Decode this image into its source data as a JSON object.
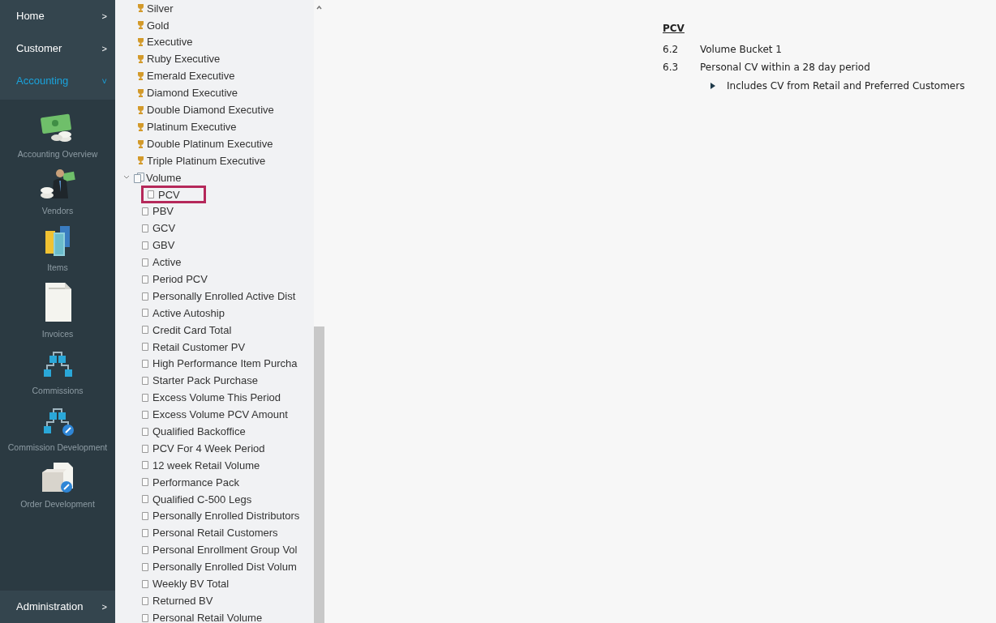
{
  "sidebar": {
    "menu_top": [
      {
        "label": "Home",
        "chevron": ">",
        "expanded": false
      },
      {
        "label": "Customer",
        "chevron": ">",
        "expanded": false
      },
      {
        "label": "Accounting",
        "chevron": "˅",
        "expanded": true
      }
    ],
    "modules": [
      {
        "label": "Accounting Overview",
        "kind": "money"
      },
      {
        "label": "Vendors",
        "kind": "vendor"
      },
      {
        "label": "Items",
        "kind": "books"
      },
      {
        "label": "Invoices",
        "kind": "invoice"
      },
      {
        "label": "Commissions",
        "kind": "orgchart"
      },
      {
        "label": "Commission Development",
        "kind": "orgchart-edit"
      },
      {
        "label": "Order Development",
        "kind": "box-edit"
      }
    ],
    "menu_bottom": [
      {
        "label": "Administration",
        "chevron": ">",
        "expanded": false
      }
    ]
  },
  "tree": [
    {
      "label": "Silver",
      "kind": "rank"
    },
    {
      "label": "Gold",
      "kind": "rank"
    },
    {
      "label": "Executive",
      "kind": "rank"
    },
    {
      "label": "Ruby Executive",
      "kind": "rank"
    },
    {
      "label": "Emerald Executive",
      "kind": "rank"
    },
    {
      "label": "Diamond Executive",
      "kind": "rank"
    },
    {
      "label": "Double Diamond Executive",
      "kind": "rank"
    },
    {
      "label": "Platinum Executive",
      "kind": "rank"
    },
    {
      "label": "Double Platinum Executive",
      "kind": "rank"
    },
    {
      "label": "Triple Platinum Executive",
      "kind": "rank"
    },
    {
      "label": "Volume",
      "kind": "folder",
      "expanded": true,
      "children": [
        {
          "label": "PCV",
          "selected": true
        },
        {
          "label": "PBV",
          "selected": false
        },
        {
          "label": "GCV",
          "selected": false
        },
        {
          "label": "GBV",
          "selected": false
        },
        {
          "label": "Active",
          "selected": false
        },
        {
          "label": "Period PCV",
          "selected": false
        },
        {
          "label": "Personally Enrolled Active Dist",
          "selected": false
        },
        {
          "label": "Active Autoship",
          "selected": false
        },
        {
          "label": "Credit Card Total",
          "selected": false
        },
        {
          "label": "Retail Customer PV",
          "selected": false
        },
        {
          "label": "High Performance Item Purcha",
          "selected": false
        },
        {
          "label": "Starter Pack Purchase",
          "selected": false
        },
        {
          "label": "Excess Volume This Period",
          "selected": false
        },
        {
          "label": "Excess Volume PCV Amount",
          "selected": false
        },
        {
          "label": "Qualified Backoffice",
          "selected": false
        },
        {
          "label": "PCV For 4 Week Period",
          "selected": false
        },
        {
          "label": "12 week Retail Volume",
          "selected": false
        },
        {
          "label": "Performance Pack",
          "selected": false
        },
        {
          "label": "Qualified C-500 Legs",
          "selected": false
        },
        {
          "label": "Personally Enrolled Distributors",
          "selected": false
        },
        {
          "label": "Personal Retail Customers",
          "selected": false
        },
        {
          "label": "Personal Enrollment Group Vol",
          "selected": false
        },
        {
          "label": "Personally Enrolled Dist Volum",
          "selected": false
        },
        {
          "label": "Weekly BV Total",
          "selected": false
        },
        {
          "label": "Returned BV",
          "selected": false
        },
        {
          "label": "Personal Retail Volume",
          "selected": false
        }
      ]
    }
  ],
  "detail": {
    "title": "PCV",
    "rows": [
      {
        "number": "6.2",
        "text": "Volume Bucket 1"
      },
      {
        "number": "6.3",
        "text": "Personal CV within a 28 day period"
      }
    ],
    "bullets": [
      "Includes CV from Retail and Preferred Customers"
    ]
  }
}
